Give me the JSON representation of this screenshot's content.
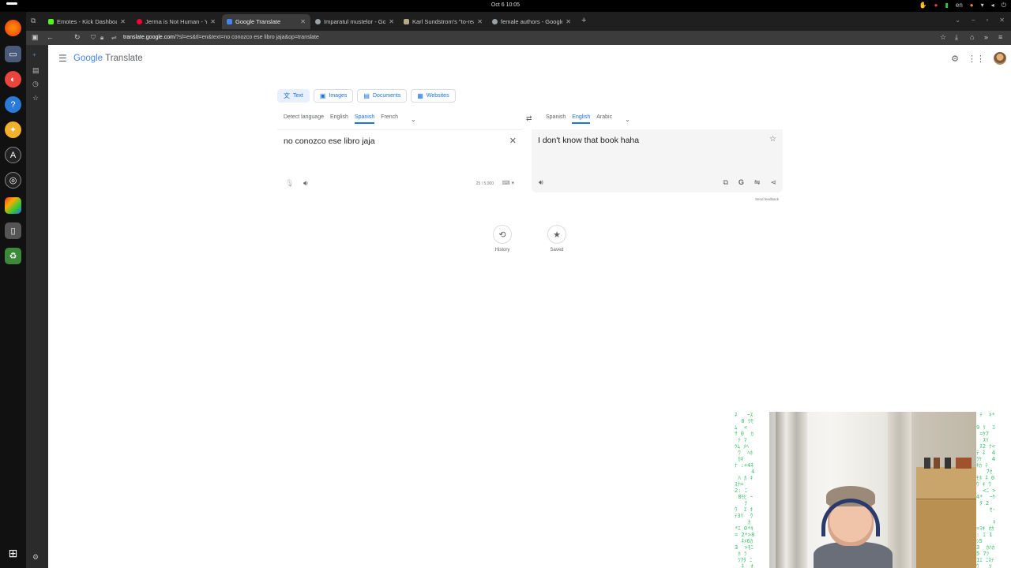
{
  "topbar": {
    "clock": "Oct 6  10:05",
    "language": "en"
  },
  "browser": {
    "tabs": [
      {
        "title": "Emotes - Kick Dashboard",
        "favicon_color": "#53fc18",
        "active": false
      },
      {
        "title": "Jerma is Not Human - Yo",
        "favicon_color": "#ff0033",
        "active": false
      },
      {
        "title": "Google Translate",
        "favicon_color": "#4285f4",
        "active": true
      },
      {
        "title": "Imparatul mustelor - Goo",
        "favicon_color": "#9aa0a6",
        "active": false
      },
      {
        "title": "Karl Sundstrom's \"to-read\"",
        "favicon_color": "#b7a88a",
        "active": false
      },
      {
        "title": "female authors - Google",
        "favicon_color": "#9aa0a6",
        "active": false
      }
    ],
    "url_host": "translate.google.com",
    "url_rest": "/?sl=es&tl=en&text=no conozco ese libro jaja&op=translate"
  },
  "app": {
    "title": "Google Translate",
    "title_google": "Google",
    "title_product": "Translate"
  },
  "modes": {
    "text": "Text",
    "images": "Images",
    "documents": "Documents",
    "websites": "Websites"
  },
  "source_languages": {
    "detect": "Detect language",
    "items": [
      "English",
      "Spanish",
      "French"
    ],
    "selected": "Spanish"
  },
  "target_languages": {
    "items": [
      "Spanish",
      "English",
      "Arabic"
    ],
    "selected": "English"
  },
  "source": {
    "text": "no conozco ese libro jaja",
    "char_count": "25 / 5,000"
  },
  "target": {
    "text": "I don't know that book haha"
  },
  "feedback": "Send feedback",
  "bottom_links": {
    "history": "History",
    "saved": "Saved"
  },
  "colors": {
    "accent": "#1a73e8",
    "active_mode_bg": "#e8f0fe",
    "target_box_bg": "#f5f5f5"
  }
}
